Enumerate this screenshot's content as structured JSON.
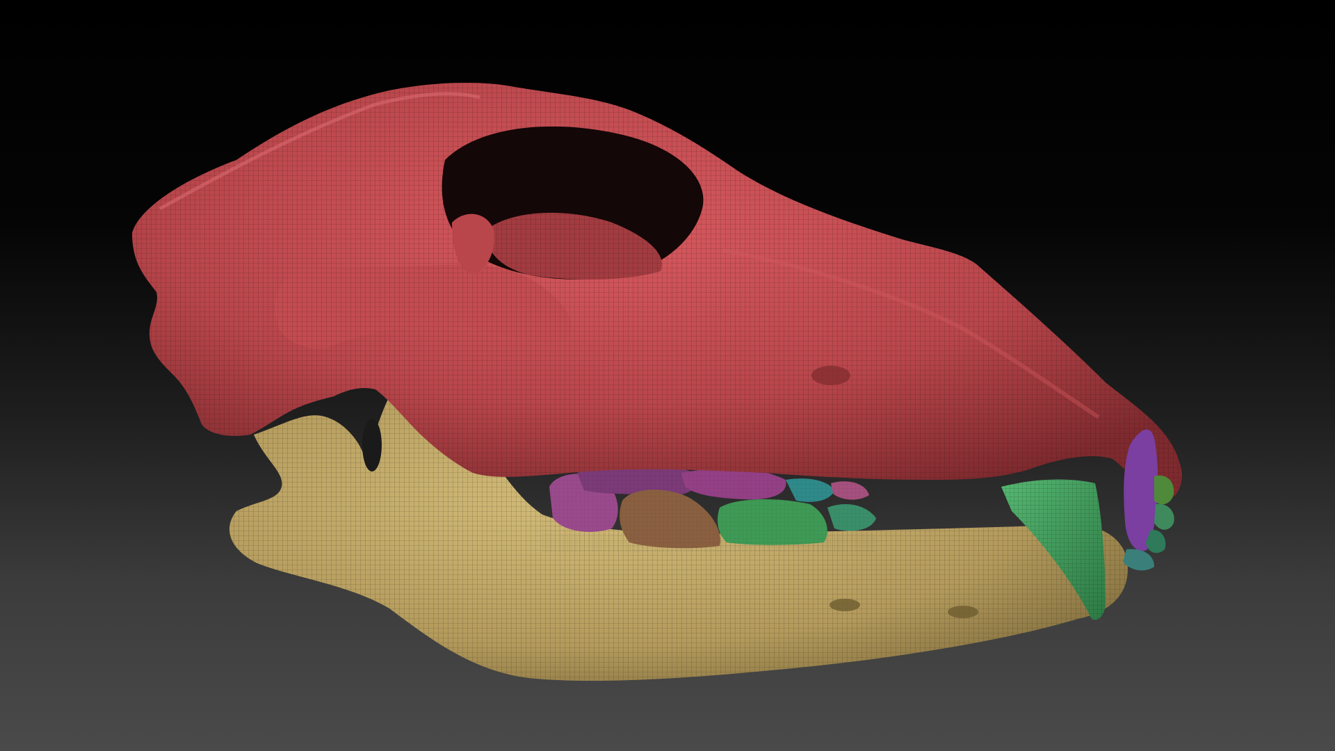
{
  "scene": {
    "subject": "skull-3d-model",
    "colors": {
      "background_top": "#000000",
      "background_bottom": "#4a4a4a",
      "cranium": "#c24a4f",
      "mandible": "#bfa766",
      "canine_upper": "#3f9a5c",
      "incisor": "#7a3fa0",
      "premolar_purple": "#7b3a78",
      "premolar_magenta": "#9a4a8c",
      "molar_brown": "#8a6040",
      "molar_green": "#3f9a55",
      "molar_teal": "#2f8a8a",
      "wireframe": "#2a1010"
    }
  }
}
